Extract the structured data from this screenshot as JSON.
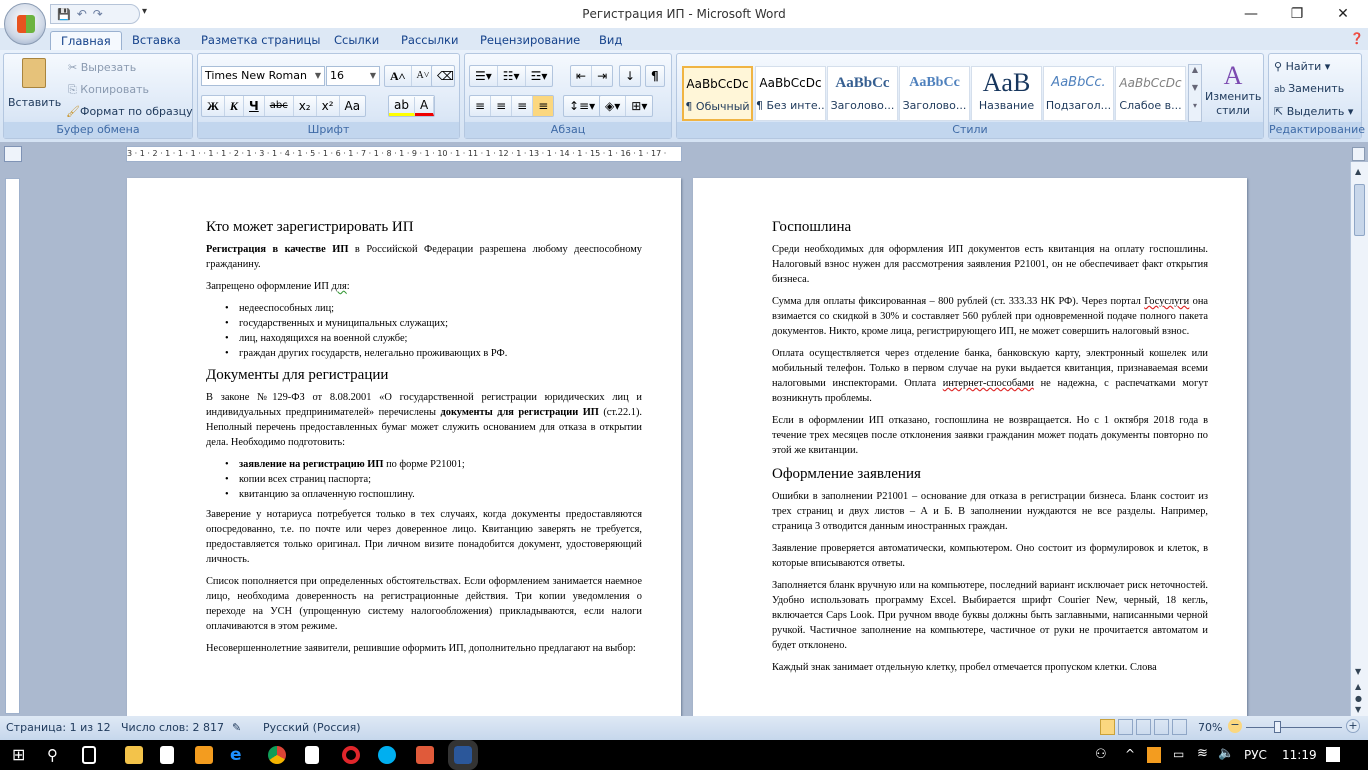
{
  "window": {
    "title": "Регистрация ИП - Microsoft Word",
    "minimize": "—",
    "maximize": "❐",
    "close": "✕"
  },
  "qat": {
    "save": "💾",
    "undo": "↶",
    "redo": "↷",
    "more": "▾"
  },
  "tabs": [
    "Главная",
    "Вставка",
    "Разметка страницы",
    "Ссылки",
    "Рассылки",
    "Рецензирование",
    "Вид"
  ],
  "clipboard": {
    "paste": "Вставить",
    "cut": "Вырезать",
    "copy": "Копировать",
    "format_painter": "Формат по образцу",
    "label": "Буфер обмена"
  },
  "font": {
    "name": "Times New Roman",
    "size": "16",
    "label": "Шрифт",
    "bold": "Ж",
    "italic": "К",
    "underline": "Ч",
    "strike": "abc",
    "sub": "x₂",
    "sup": "x²",
    "case": "Aa",
    "grow": "A˄",
    "shrink": "A˅"
  },
  "paragraph": {
    "label": "Абзац",
    "pilcrow": "¶"
  },
  "styles": {
    "label": "Стили",
    "change": "Изменить стили",
    "items": [
      {
        "sample": "AaBbCcDc",
        "name": "¶ Обычный"
      },
      {
        "sample": "AaBbCcDc",
        "name": "¶ Без инте..."
      },
      {
        "sample": "AaBbCc",
        "name": "Заголово..."
      },
      {
        "sample": "AaBbCc",
        "name": "Заголово..."
      },
      {
        "sample": "AaB",
        "name": "Название"
      },
      {
        "sample": "AaBbCc.",
        "name": "Подзагол..."
      },
      {
        "sample": "AaBbCcDc",
        "name": "Слабое в..."
      }
    ]
  },
  "editing": {
    "label": "Редактирование",
    "find": "Найти",
    "replace": "Заменить",
    "select": "Выделить"
  },
  "ruler": "3 · 1 · 2 · 1 · 1 · 1 ·   · 1 · 1 · 2 · 1 · 3 · 1 · 4 · 1 · 5 · 1 · 6 · 1 · 7 · 1 · 8 · 1 · 9 · 1 · 10 · 1 · 11 · 1 · 12 · 1 · 13 · 1 · 14 · 1 · 15 · 1 · 16 · 1 · 17 ·",
  "left_page": {
    "h1": "Кто может зарегистрировать ИП",
    "p1_bold": "Регистрация в качестве ИП",
    "p1": " в Российской Федерации разрешена любому дееспособному гражданину.",
    "p2a": "Запрещено оформление ИП ",
    "p2b": "для",
    ":": ":",
    "list1": [
      "недееспособных лиц;",
      "государственных и муниципальных служащих;",
      "лиц, находящихся на военной службе;",
      "граждан других государств, нелегально проживающих в РФ."
    ],
    "h2": "Документы для регистрации",
    "p3a": "В законе №129-ФЗ от 8.08.2001 «О государственной регистрации юридических лиц и индивидуальных предпринимателей» перечислены ",
    "p3b": "документы для регистрации ИП",
    "p3c": " (ст.22.1). Неполный перечень предоставленных бумаг может служить основанием для отказа в открытии дела. Необходимо подготовить:",
    "l2a_bold": "заявление на регистрацию ИП",
    "l2a": " по форме Р21001;",
    "l2b": "копии всех страниц паспорта;",
    "l2c": "квитанцию за оплаченную госпошлину.",
    "p4": "Заверение у нотариуса потребуется только в тех случаях, когда документы предоставляются опосредованно, т.е. по почте или через доверенное лицо. Квитанцию заверять не требуется, предоставляется только оригинал. При личном визите понадобится документ, удостоверяющий личность.",
    "p5": "Список пополняется при определенных обстоятельствах. Если оформлением занимается наемное лицо, необходима доверенность на регистрационные действия. Три копии уведомления о переходе на УСН (упрощенную систему налогообложения) прикладываются, если налоги оплачиваются в этом режиме.",
    "p6": "Несовершеннолетние заявители, решившие оформить ИП, дополнительно предлагают на выбор:"
  },
  "right_page": {
    "h1": "Госпошлина",
    "p1": "Среди необходимых для оформления ИП документов есть квитанция на оплату госпошлины. Налоговый взнос нужен для рассмотрения заявления Р21001, он не обеспечивает факт открытия бизнеса.",
    "p2a": "Сумма для оплаты фиксированная – 800 рублей (ст. 333.33 НК РФ). Через портал ",
    "p2b": "Госуслуги",
    "p2c": " она взимается со скидкой в 30% и составляет 560 рублей при одновременной подаче полного пакета документов. Никто, кроме лица, регистрирующего ИП, не может совершить налоговый взнос.",
    "p3a": "Оплата осуществляется через отделение банка, банковскую карту, электронный кошелек или мобильный телефон. Только в первом случае на руки выдается квитанция, признаваемая всеми налоговыми инспекторами. Оплата ",
    "p3b": "интернет-способами",
    "p3c": " не надежна, с распечатками могут возникнуть проблемы.",
    "p4": "Если в оформлении ИП отказано, госпошлина не возвращается. Но с 1 октября 2018 года в течение трех месяцев после отклонения заявки гражданин может подать документы повторно по этой же квитанции.",
    "h2": "Оформление заявления",
    "p5": "Ошибки в заполнении Р21001 – основание для отказа в регистрации бизнеса. Бланк состоит из трех страниц и двух листов – А и Б. В заполнении нуждаются не все разделы. Например, страница 3 отводится данным иностранных граждан.",
    "p6": "Заявление проверяется автоматически, компьютером. Оно состоит из формулировок и клеток, в которые вписываются ответы.",
    "p7": "Заполняется бланк вручную или на компьютере, последний вариант исключает риск неточностей. Удобно использовать программу Excel. Выбирается шрифт Courier New, черный, 18 кегль, включается Caps Look. При ручном вводе буквы должны быть заглавными, написанными черной ручкой. Частичное заполнение на компьютере, частичное от руки не прочитается автоматом и будет отклонено.",
    "p8": "Каждый знак занимает отдельную клетку, пробел отмечается пропуском клетки. Слова"
  },
  "status": {
    "page": "Страница: 1 из 12",
    "words": "Число слов: 2 817",
    "language": "Русский (Россия)",
    "zoom": "70%",
    "zoom_percent": 70
  },
  "taskbar": {
    "lang": "РУС",
    "time": "11:19"
  }
}
